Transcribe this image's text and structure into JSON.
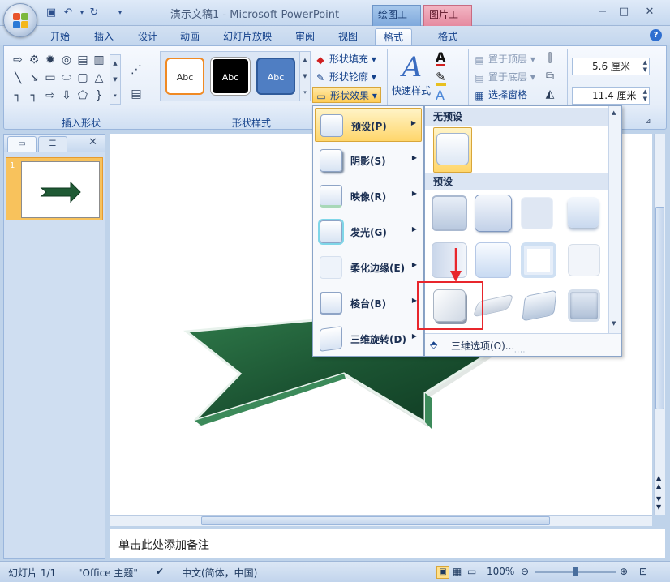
{
  "titlebar": {
    "title": "演示文稿1 - Microsoft PowerPoint",
    "context_tab_drawing": "绘图工具",
    "context_tab_picture": "图片工具",
    "minimize": "−",
    "maximize": "□",
    "close": "✕"
  },
  "tabs": [
    {
      "label": "开始"
    },
    {
      "label": "插入"
    },
    {
      "label": "设计"
    },
    {
      "label": "动画"
    },
    {
      "label": "幻灯片放映"
    },
    {
      "label": "审阅"
    },
    {
      "label": "视图"
    },
    {
      "label": "格式"
    },
    {
      "label": "格式"
    }
  ],
  "ribbon": {
    "insert_shapes_label": "插入形状",
    "shape_styles_label": "形状样式",
    "swatch_text": "Abc",
    "shape_fill": "形状填充",
    "shape_outline": "形状轮廓",
    "shape_effects": "形状效果",
    "quick_styles": "快速样式",
    "bring_front": "置于顶层",
    "send_back": "置于底层",
    "selection_pane": "选择窗格",
    "height_value": "5.6 厘米",
    "width_value": "11.4 厘米"
  },
  "effects_menu": {
    "items": [
      {
        "label": "预设(P)"
      },
      {
        "label": "阴影(S)"
      },
      {
        "label": "映像(R)"
      },
      {
        "label": "发光(G)"
      },
      {
        "label": "柔化边缘(E)"
      },
      {
        "label": "棱台(B)"
      },
      {
        "label": "三维旋转(D)"
      }
    ]
  },
  "gallery": {
    "no_preset": "无预设",
    "preset": "预设",
    "more_options": "三维选项(O)..."
  },
  "left_pane": {
    "slide_number": "1"
  },
  "notes": {
    "placeholder": "单击此处添加备注"
  },
  "status": {
    "slide": "幻灯片 1/1",
    "theme": "\"Office 主题\"",
    "language": "中文(简体，中国)",
    "zoom": "100%"
  },
  "colors": {
    "accent_blue": "#15428b",
    "arrow_green": "#1f5a35",
    "highlight": "#e8262c"
  }
}
